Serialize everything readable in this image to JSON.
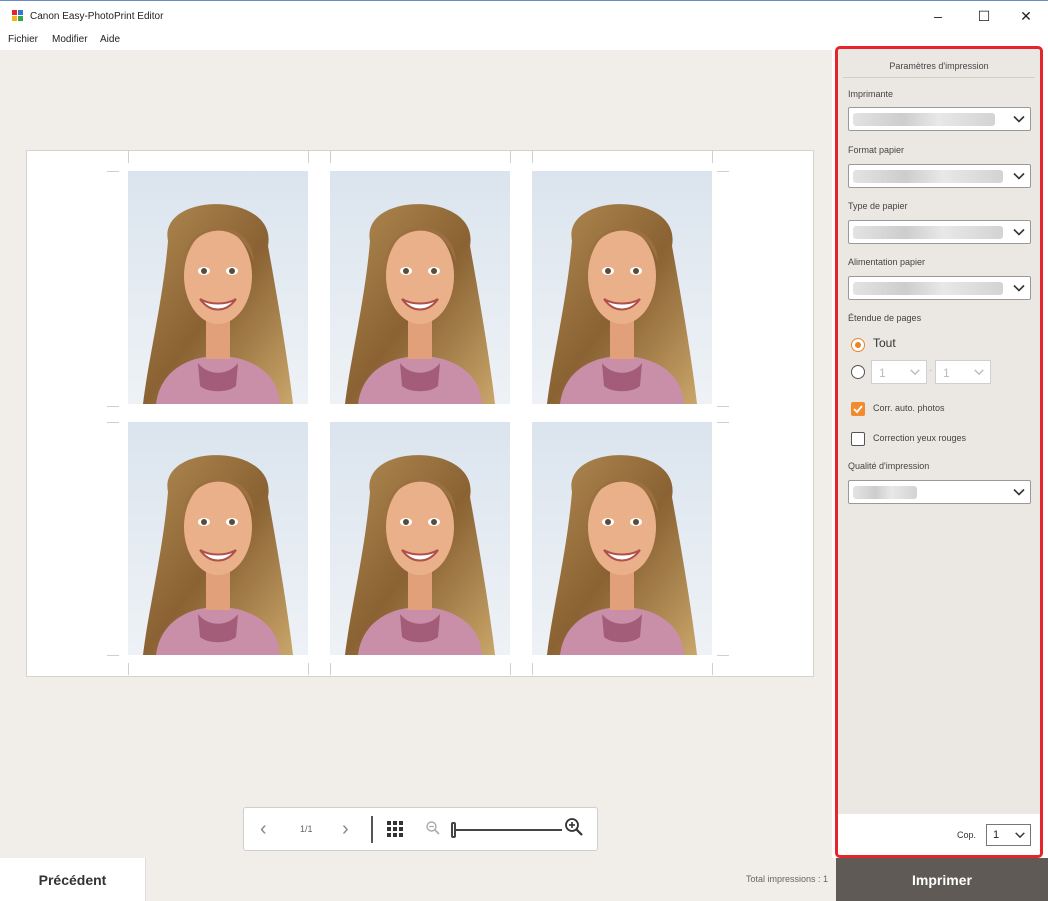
{
  "window": {
    "title": "Canon Easy-PhotoPrint Editor",
    "minimize_glyph": "–",
    "maximize_glyph": "☐",
    "close_glyph": "✕"
  },
  "menu": [
    "Fichier",
    "Modifier",
    "Aide"
  ],
  "preview": {
    "photos_count": 6,
    "page_indicator": "1/1",
    "prev_glyph": "‹",
    "next_glyph": "›",
    "zoom_level_fraction": 0.0
  },
  "panel": {
    "title": "Paramètres d'impression",
    "printer_label": "Imprimante",
    "paper_size_label": "Format papier",
    "paper_type_label": "Type de papier",
    "paper_source_label": "Alimentation papier",
    "page_range_label": "Étendue de pages",
    "page_range_all": "Tout",
    "page_from": "1",
    "page_to": "1",
    "auto_photo_fix": "Corr. auto. photos",
    "auto_photo_fix_checked": true,
    "red_eye": "Correction yeux rouges",
    "red_eye_checked": false,
    "print_quality_label": "Qualité d'impression",
    "copies_label": "Cop.",
    "copies_value": "1"
  },
  "footer": {
    "back_label": "Précédent",
    "total_label": "Total impressions : 1",
    "print_label": "Imprimer"
  },
  "colors": {
    "accent_orange": "#f08c2e",
    "highlight_red": "#e5252a",
    "print_button": "#5f5a55",
    "canvas_bg": "#f1eee9"
  }
}
